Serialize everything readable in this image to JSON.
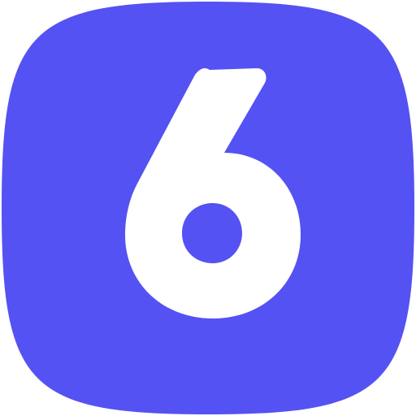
{
  "icon": {
    "name": "number-six-icon",
    "glyph": "6",
    "colors": {
      "tile": "#5452F3",
      "glyph": "#FFFFFF",
      "page": "#FFFFFF"
    }
  }
}
